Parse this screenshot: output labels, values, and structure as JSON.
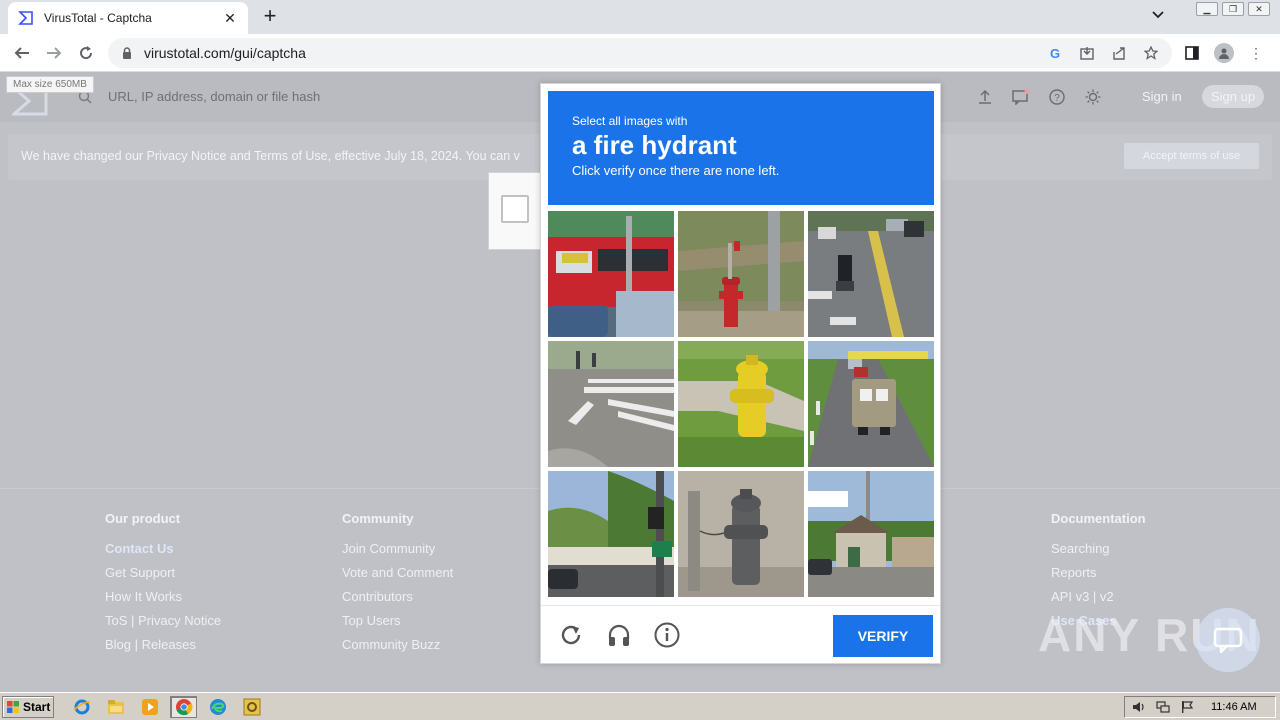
{
  "browser": {
    "tab_title": "VirusTotal - Captcha",
    "url": "virustotal.com/gui/captcha"
  },
  "page": {
    "tooltip": "Max size 650MB",
    "search_placeholder": "URL, IP address, domain or file hash",
    "sign_in": "Sign in",
    "sign_up": "Sign up",
    "privacy_notice": "We have changed our Privacy Notice and Terms of Use, effective July 18, 2024. You can v",
    "accept_terms": "Accept terms of use"
  },
  "footer": {
    "our_product": {
      "heading": "Our product",
      "items": [
        "Contact Us",
        "Get Support",
        "How It Works",
        "ToS | Privacy Notice",
        "Blog | Releases"
      ]
    },
    "community": {
      "heading": "Community",
      "items": [
        "Join Community",
        "Vote and Comment",
        "Contributors",
        "Top Users",
        "Community Buzz"
      ]
    },
    "documentation": {
      "heading": "Documentation",
      "items": [
        "Searching",
        "Reports",
        "API v3 | v2",
        "Use Cases"
      ]
    }
  },
  "captcha": {
    "prompt_small": "Select all images with",
    "prompt_big": "a fire hydrant",
    "prompt_sub": "Click verify once there are none left.",
    "verify_label": "VERIFY",
    "tiles": [
      "bus-street",
      "red-fire-hydrant",
      "motorcycle-road",
      "crosswalk",
      "yellow-fire-hydrant",
      "cars-road",
      "street-signs",
      "gray-fire-hydrant",
      "village-street"
    ]
  },
  "watermark": "ANY RUN",
  "taskbar": {
    "start_label": "Start",
    "clock": "11:46 AM"
  }
}
